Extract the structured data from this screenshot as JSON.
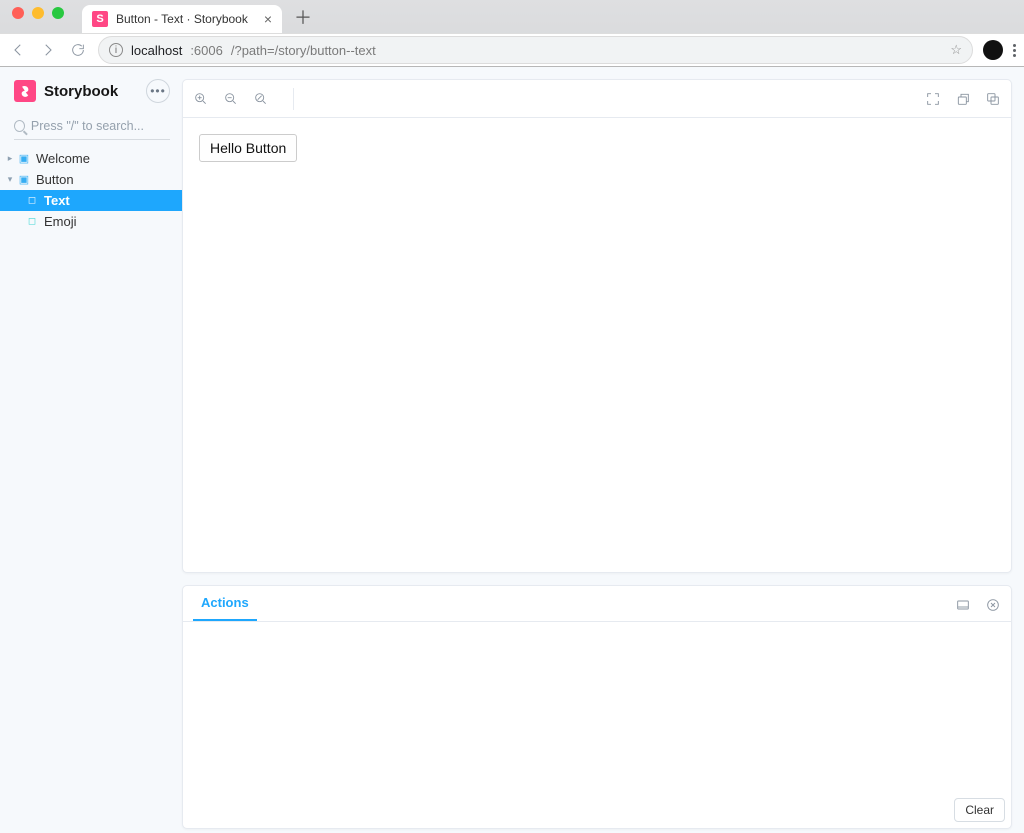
{
  "browser": {
    "tab_title": "Button - Text · Storybook",
    "url_host": "localhost",
    "url_port": ":6006",
    "url_path": "/?path=/story/button--text"
  },
  "sidebar": {
    "brand": "Storybook",
    "search_placeholder": "Press \"/\" to search...",
    "groups": [
      {
        "label": "Welcome",
        "expanded": false
      },
      {
        "label": "Button",
        "expanded": true
      }
    ],
    "stories": [
      {
        "label": "Text",
        "selected": true
      },
      {
        "label": "Emoji",
        "selected": false
      }
    ]
  },
  "canvas": {
    "button_label": "Hello Button"
  },
  "addons": {
    "tab_label": "Actions",
    "clear_label": "Clear"
  }
}
